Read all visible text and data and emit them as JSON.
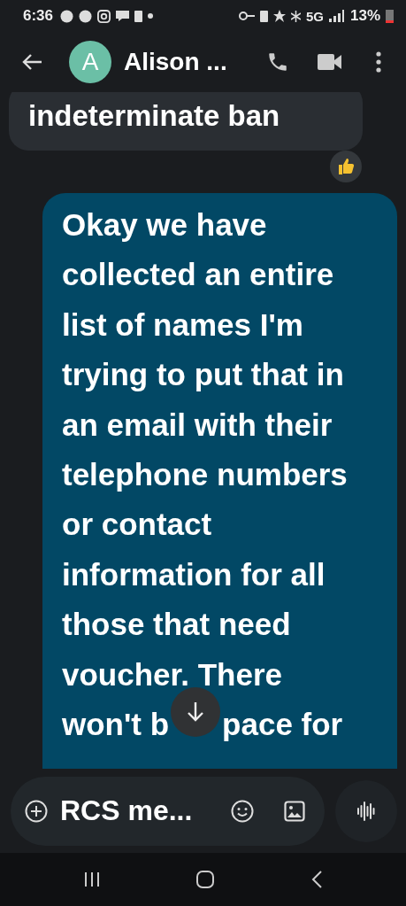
{
  "status_bar": {
    "time": "6:36",
    "network": "5G",
    "battery": "13%"
  },
  "header": {
    "avatar_letter": "A",
    "contact_name": "Alison ..."
  },
  "messages": [
    {
      "kind": "incoming",
      "text": "indeterminate ban",
      "reaction": true
    },
    {
      "kind": "outgoing",
      "text": "Okay we have collected an entire list of names I'm trying to put that in an email with their telephone numbers or contact information for all those that need voucher. There",
      "tail": [
        "won't b",
        "pace for"
      ]
    }
  ],
  "compose": {
    "placeholder": "RCS me..."
  }
}
